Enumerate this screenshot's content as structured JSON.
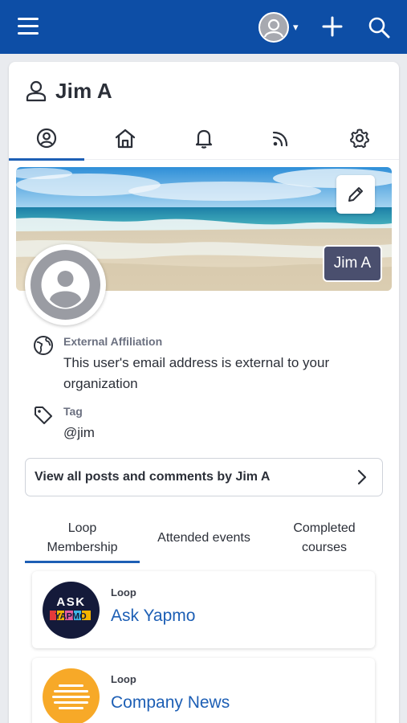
{
  "header": {
    "menu_icon": "hamburger-menu-icon",
    "account_icon": "user-avatar-icon",
    "caret": "▾",
    "add_icon": "plus-icon",
    "search_icon": "search-icon",
    "bar_color": "#0d4ea6"
  },
  "profile": {
    "name": "Jim A",
    "cover_name_chip": "Jim A",
    "tabs": [
      {
        "icon": "profile-icon",
        "active": true
      },
      {
        "icon": "home-icon",
        "active": false
      },
      {
        "icon": "bell-icon",
        "active": false
      },
      {
        "icon": "rss-feed-icon",
        "active": false
      },
      {
        "icon": "gear-icon",
        "active": false
      }
    ],
    "edit_cover_icon": "pencil-icon",
    "affiliation": {
      "label": "External Affiliation",
      "value": "This user's email address is external to your organization",
      "icon": "globe-icon"
    },
    "tag": {
      "label": "Tag",
      "value": "@jim",
      "icon": "tag-icon"
    },
    "posts_link": "View all posts and comments by Jim A"
  },
  "sub_tabs": [
    {
      "label": "Loop Membership",
      "active": true
    },
    {
      "label": "Attended events",
      "active": false
    },
    {
      "label": "Completed courses",
      "active": false
    }
  ],
  "loops": [
    {
      "kind": "Loop",
      "name": "Ask Yapmo",
      "logo_text": "ASK",
      "logo_word": "YAPMO"
    },
    {
      "kind": "Loop",
      "name": "Company News"
    }
  ],
  "accent_color": "#1d5fb5"
}
